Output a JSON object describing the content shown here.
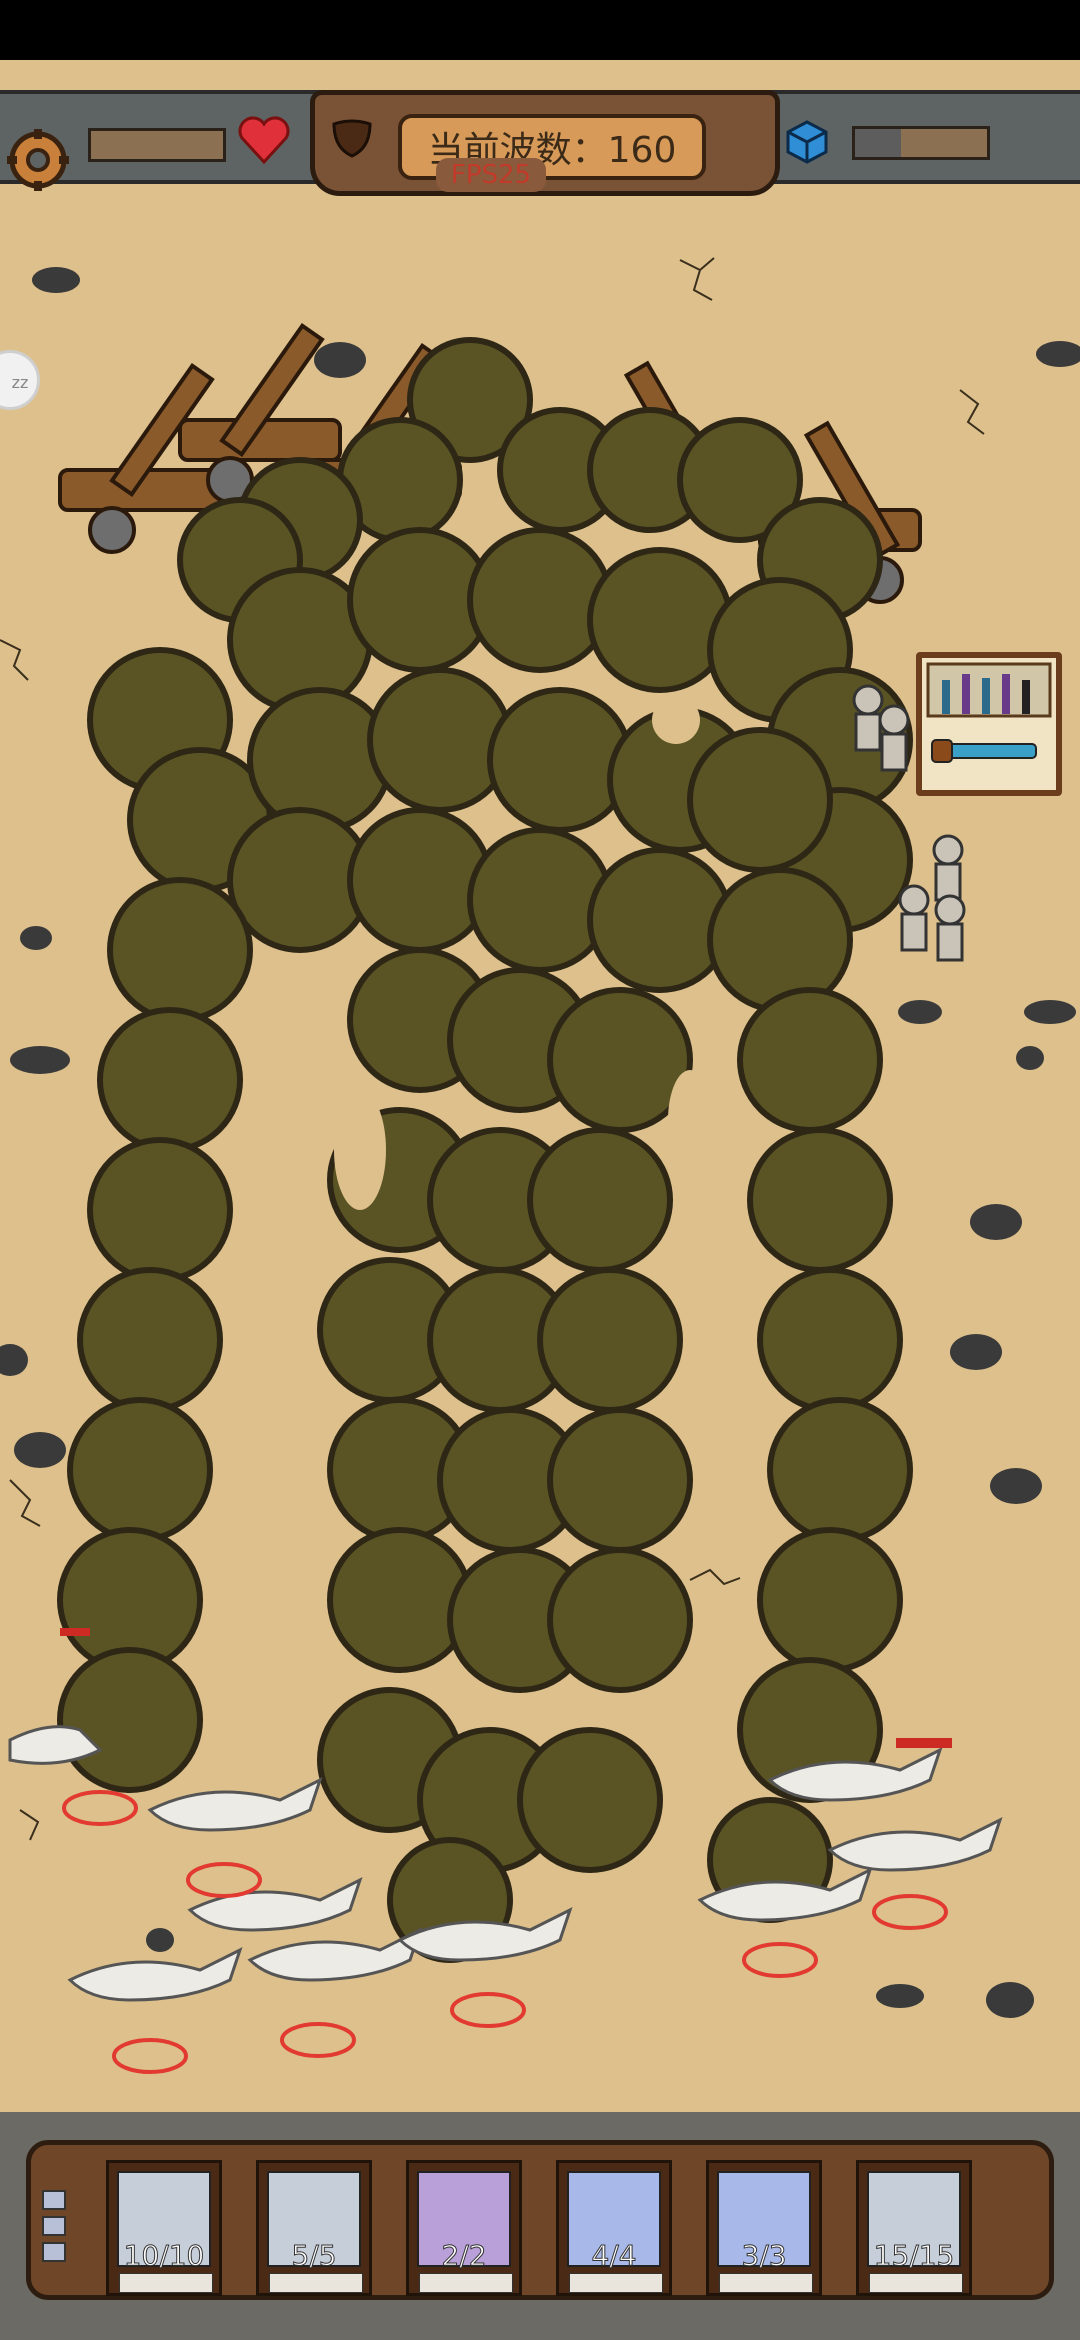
{
  "hud": {
    "wave_label": "当前波数：160",
    "fps_label": "FPS25",
    "side_button_label": "zz",
    "health_fill": 0,
    "gem_fill": 0.35
  },
  "units": [
    {
      "count": "10/10",
      "color": "#c6ced9"
    },
    {
      "count": "5/5",
      "color": "#c6ced9"
    },
    {
      "count": "2/2",
      "color": "#b9a0d8"
    },
    {
      "count": "4/4",
      "color": "#a8b8e8"
    },
    {
      "count": "3/3",
      "color": "#a8b8e8"
    },
    {
      "count": "15/15",
      "color": "#c6ced9"
    }
  ],
  "colors": {
    "sand": "#ddc08c",
    "golem": "#5a5424",
    "golem_outline": "#2e2716",
    "wolf": "#ecebe6",
    "target_ring": "#e23a30"
  }
}
